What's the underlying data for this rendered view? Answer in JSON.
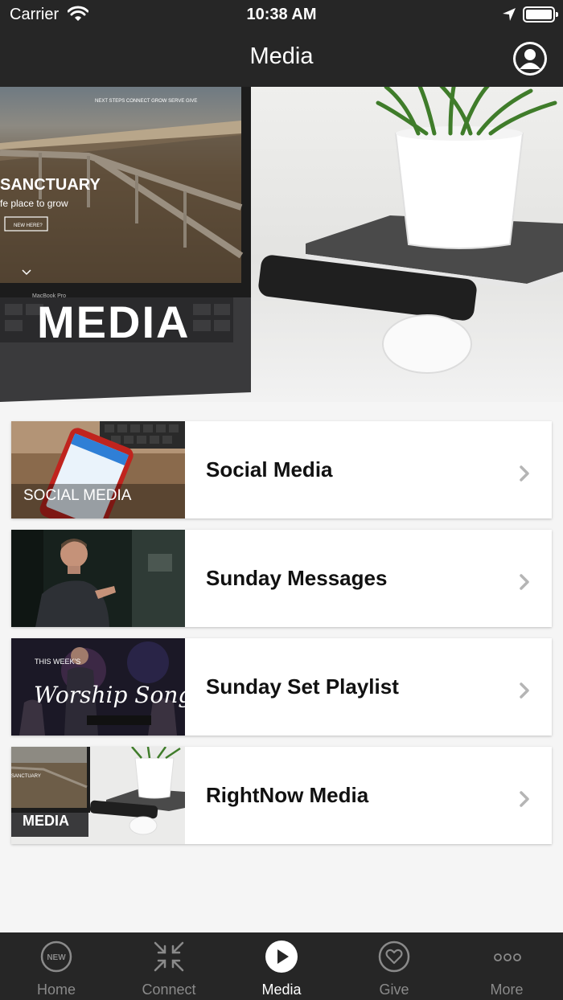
{
  "status_bar": {
    "carrier": "Carrier",
    "time": "10:38 AM"
  },
  "nav": {
    "title": "Media"
  },
  "hero": {
    "overlay_text": "MEDIA",
    "screen_title": "SANCTUARY",
    "screen_subtitle": "fe place to grow",
    "screen_button": "NEW HERE?",
    "screen_nav": "NEXT STEPS   CONNECT   GROW   SERVE   GIVE",
    "laptop_brand": "MacBook Pro"
  },
  "items": [
    {
      "label": "Social Media",
      "thumb_caption": "SOCIAL MEDIA"
    },
    {
      "label": "Sunday Messages",
      "thumb_caption": ""
    },
    {
      "label": "Sunday Set Playlist",
      "thumb_caption": "THIS WEEK'S",
      "thumb_script": "Worship Songs"
    },
    {
      "label": "RightNow Media",
      "thumb_caption": "MEDIA",
      "thumb_sub": "SANCTUARY"
    }
  ],
  "tabs": [
    {
      "label": "Home",
      "icon": "new-badge-icon",
      "badge": "NEW"
    },
    {
      "label": "Connect",
      "icon": "connect-arrows-icon"
    },
    {
      "label": "Media",
      "icon": "play-icon"
    },
    {
      "label": "Give",
      "icon": "heart-icon"
    },
    {
      "label": "More",
      "icon": "more-dots-icon"
    }
  ],
  "colors": {
    "bar": "#262626",
    "active": "#ffffff",
    "inactive": "#8a8a8a",
    "background": "#f5f5f5"
  }
}
